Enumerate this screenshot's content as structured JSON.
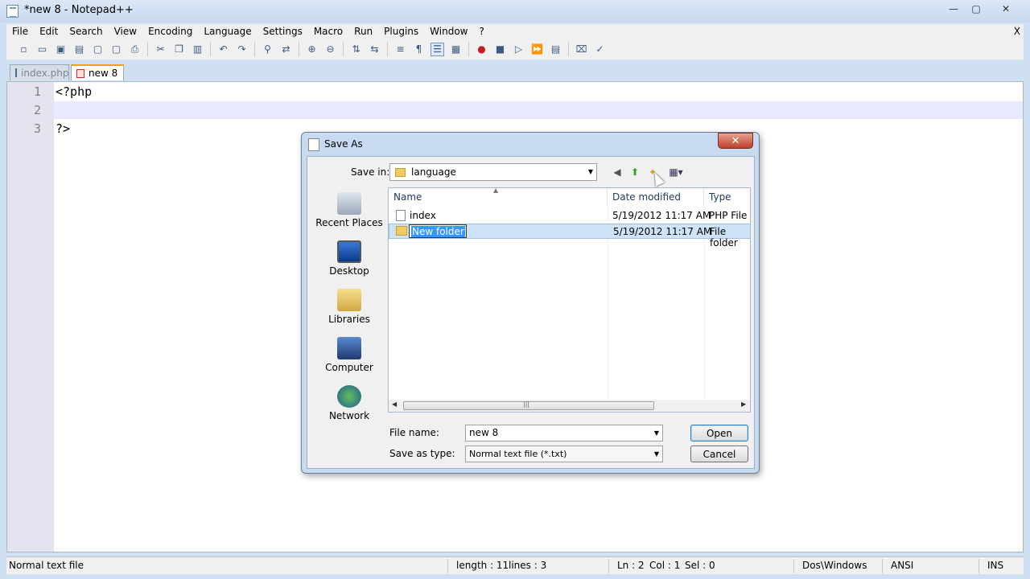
{
  "window": {
    "title": "*new  8 - Notepad++",
    "controls": {
      "minimize": "—",
      "maximize": "▢",
      "close": "✕"
    }
  },
  "menu": {
    "items": [
      "File",
      "Edit",
      "Search",
      "View",
      "Encoding",
      "Language",
      "Settings",
      "Macro",
      "Run",
      "Plugins",
      "Window",
      "?"
    ],
    "close_label": "X"
  },
  "toolbar": {
    "icons": [
      "new-file-icon",
      "open-file-icon",
      "save-icon",
      "save-all-icon",
      "close-icon",
      "close-all-icon",
      "print-icon",
      "cut-icon",
      "copy-icon",
      "paste-icon",
      "undo-icon",
      "redo-icon",
      "find-icon",
      "replace-icon",
      "zoom-in-icon",
      "zoom-out-icon",
      "sync-vertical-icon",
      "sync-horizontal-icon",
      "word-wrap-icon",
      "show-all-chars-icon",
      "indent-guide-icon",
      "doc-map-icon",
      "record-macro-icon",
      "stop-macro-icon",
      "play-macro-icon",
      "run-macro-multiple-icon",
      "save-macro-icon",
      "trim-icon",
      "spellcheck-icon"
    ]
  },
  "tabs": [
    {
      "label": "index.php",
      "active": false
    },
    {
      "label": "new  8",
      "active": true
    }
  ],
  "editor": {
    "lines": [
      {
        "number": "1",
        "text": "<?php"
      },
      {
        "number": "2",
        "text": ""
      },
      {
        "number": "3",
        "text": "?>"
      }
    ],
    "current_line": 2
  },
  "status": {
    "file_type": "Normal text file",
    "length": "length : 11",
    "lines": "lines : 3",
    "ln": "Ln : 2",
    "col": "Col : 1",
    "sel": "Sel : 0",
    "eol": "Dos\\Windows",
    "encoding": "ANSI",
    "mode": "INS"
  },
  "dialog": {
    "title": "Save As",
    "close_label": "✕",
    "save_in_label": "Save in:",
    "save_in_value": "language",
    "nav": {
      "back": "◀",
      "up": "⬆",
      "new_folder": "✦",
      "view": "▦▾"
    },
    "places": [
      "Recent Places",
      "Desktop",
      "Libraries",
      "Computer",
      "Network"
    ],
    "columns": [
      "Name",
      "Date modified",
      "Type"
    ],
    "files": [
      {
        "name": "index",
        "date": "5/19/2012 11:17 AM",
        "type": "PHP File"
      },
      {
        "name": "New folder",
        "date": "5/19/2012 11:17 AM",
        "type": "File folder"
      }
    ],
    "file_name_label": "File name:",
    "file_name_value": "new  8",
    "save_type_label": "Save as type:",
    "save_type_value": "Normal text file (*.txt)",
    "open_button": "Open",
    "cancel_button": "Cancel",
    "scroll_grip": "|||",
    "scroll_left": "◀",
    "scroll_right": "▶",
    "combo_arrow": "▼"
  },
  "colors": {
    "accent": "#3399ff",
    "current_line": "#e8e8ff",
    "gutter": "#e4e4f0",
    "dialog_frame": "#c7daf0"
  }
}
